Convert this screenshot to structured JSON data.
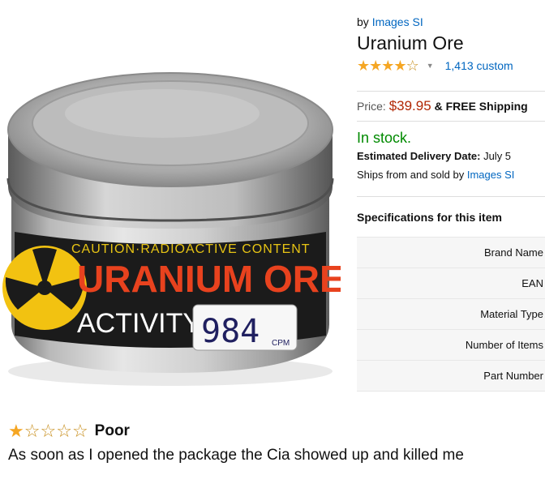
{
  "product": {
    "by_prefix": "by",
    "brand": "Images SI",
    "title": "Uranium Ore",
    "rating_stars": 4,
    "rating_max": 5,
    "reviews_count_text": "1,413 custom",
    "price_label": "Price:",
    "price": "$39.95",
    "shipping": "& FREE Shipping",
    "stock": "In stock.",
    "delivery_label": "Estimated Delivery Date:",
    "delivery_date": "July 5",
    "ships_prefix": "Ships from and sold by",
    "ships_seller": "Images SI"
  },
  "image": {
    "label_caution": "CAUTION·RADIOACTIVE CONTENT",
    "label_name": "URANIUM ORE",
    "label_activity": "ACTIVITY:",
    "label_value": "984",
    "label_unit": "CPM"
  },
  "specs": {
    "heading": "Specifications for this item",
    "rows": [
      "Brand Name",
      "EAN",
      "Material Type",
      "Number of Items",
      "Part Number"
    ]
  },
  "review": {
    "stars": 1,
    "max": 5,
    "title": "Poor",
    "body": "As soon as I opened the package the Cia showed up and killed me"
  },
  "colors": {
    "link": "#0066c0",
    "price": "#b12704",
    "stock": "#008a00",
    "star": "#f5a623"
  }
}
